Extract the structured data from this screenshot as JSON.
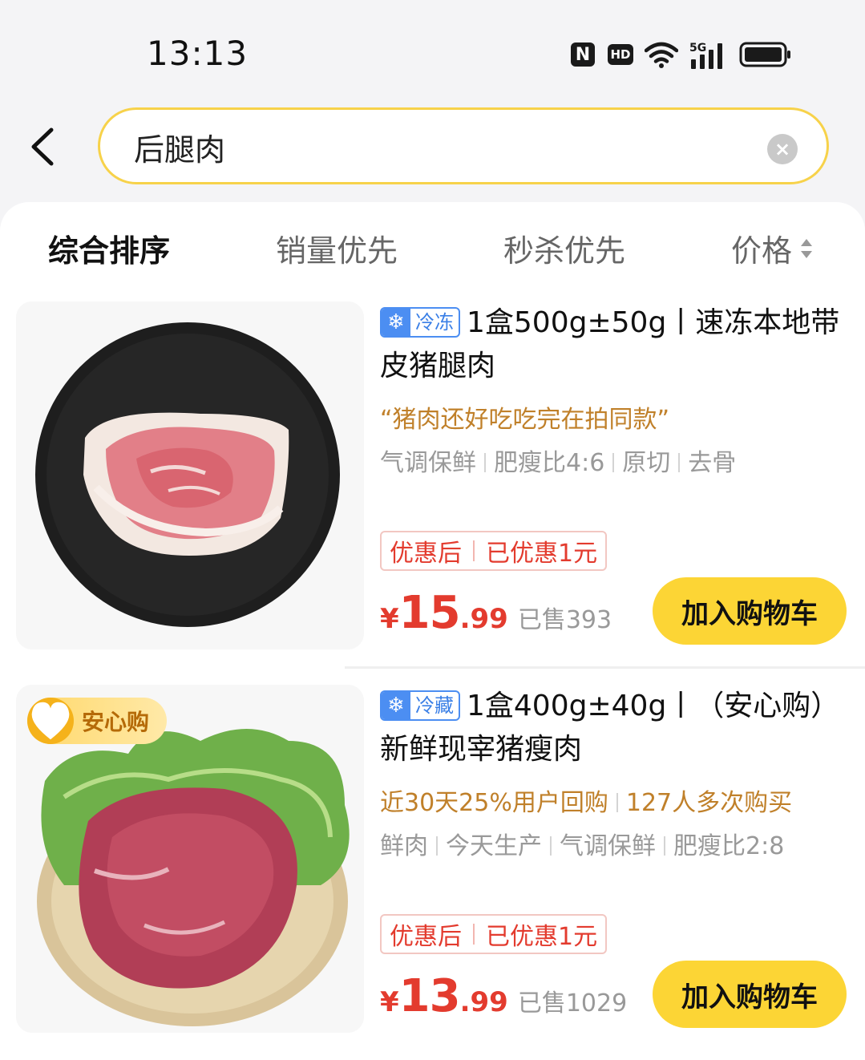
{
  "status_bar": {
    "time": "13:13",
    "nfc_label": "N",
    "hd_label": "HD",
    "network_label": "5G"
  },
  "search": {
    "value": "后腿肉",
    "clear_label": "×"
  },
  "sort_tabs": [
    {
      "label": "综合排序",
      "active": true
    },
    {
      "label": "销量优先",
      "active": false
    },
    {
      "label": "秒杀优先",
      "active": false
    },
    {
      "label": "价格",
      "active": false
    }
  ],
  "products": [
    {
      "cold_icon": "❄",
      "storage_tag": "冷冻",
      "title_line1": "1盒500g±50g丨速冻本地带",
      "title_line2": "皮猪腿肉",
      "highlight": "“猪肉还好吃吃完在拍同款”",
      "attributes": [
        "气调保鲜",
        "肥瘦比4:6",
        "原切",
        "去骨"
      ],
      "discount_left": "优惠后",
      "discount_right": "已优惠1元",
      "price_symbol": "¥",
      "price_int": "15",
      "price_dec": ".99",
      "sold": "已售393",
      "cart_label": "加入购物车"
    },
    {
      "badge": "安心购",
      "cold_icon": "❄",
      "storage_tag": "冷藏",
      "title_line1": "1盒400g±40g丨（安心购）",
      "title_line2": "新鲜现宰猪瘦肉",
      "highlight_parts": [
        "近30天25%用户回购",
        "127人多次购买"
      ],
      "attributes": [
        "鲜肉",
        "今天生产",
        "气调保鲜",
        "肥瘦比2:8"
      ],
      "discount_left": "优惠后",
      "discount_right": "已优惠1元",
      "price_symbol": "¥",
      "price_int": "13",
      "price_dec": ".99",
      "sold": "已售1029",
      "cart_label": "加入购物车"
    }
  ],
  "colors": {
    "accent_yellow": "#fcd535",
    "search_border": "#f7d24a",
    "price_red": "#e33b2e",
    "highlight_brown": "#c0802a",
    "cold_blue": "#4c8ef2"
  }
}
